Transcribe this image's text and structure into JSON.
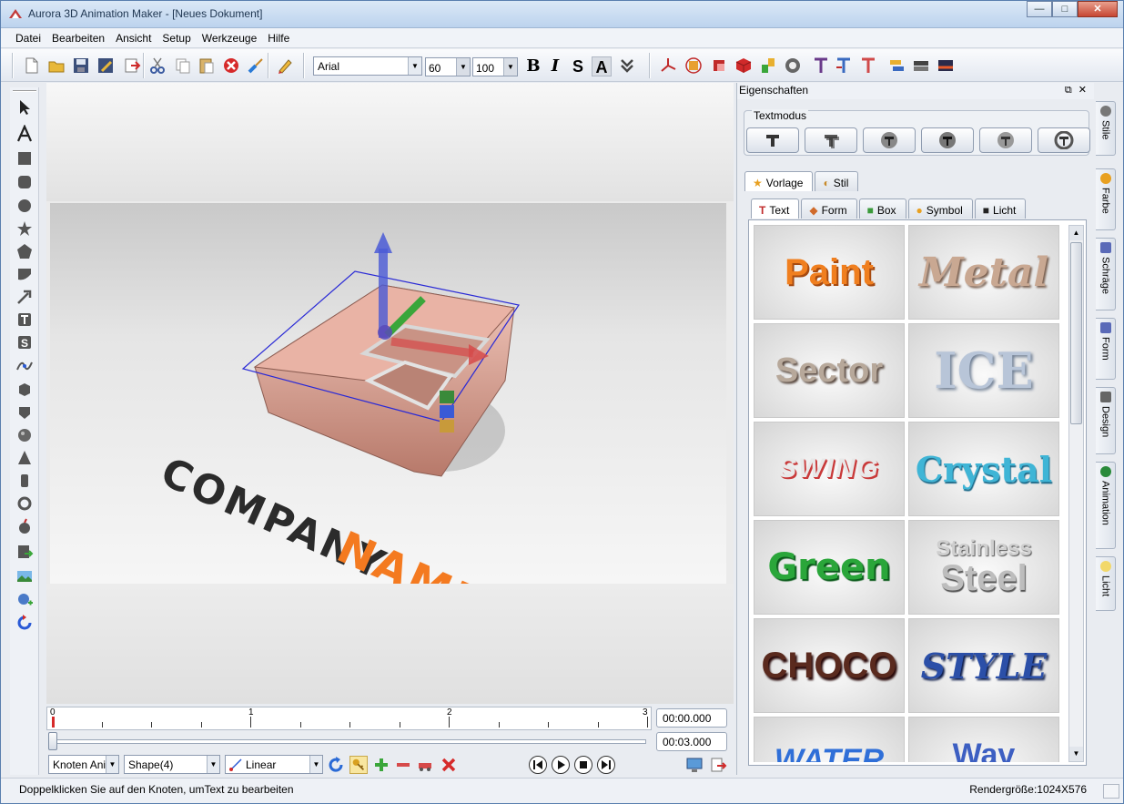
{
  "window": {
    "title": "Aurora 3D Animation Maker - [Neues Dokument]",
    "controls": {
      "minimize": "—",
      "maximize": "□",
      "close": "✕"
    }
  },
  "menu": [
    "Datei",
    "Bearbeiten",
    "Ansicht",
    "Setup",
    "Werkzeuge",
    "Hilfe"
  ],
  "toolbar": {
    "font": "Arial",
    "size": "60",
    "scale": "100",
    "bold": "B",
    "italic": "I",
    "shadow": "S",
    "outline": "A"
  },
  "canvas": {
    "text_line1": "COMPANY",
    "text_line2": "NAME",
    "colors": {
      "dark": "#2b2b2b",
      "accent": "#f47a20"
    }
  },
  "timeline": {
    "ticks": [
      "0",
      "1",
      "2",
      "3"
    ],
    "current_time": "00:00.000",
    "total_time": "00:03.000"
  },
  "bottom": {
    "anim_mode": "Knoten Ani",
    "shape": "Shape(4)",
    "interpolation": "Linear"
  },
  "status": {
    "message": "Doppelklicken Sie auf den Knoten, umText zu bearbeiten",
    "render_size": "Rendergröße:1024X576"
  },
  "properties": {
    "title": "Eigenschaften",
    "textmode_label": "Textmodus",
    "tabs_top": [
      "Vorlage",
      "Stil"
    ],
    "tabs_sub": [
      "Text",
      "Form",
      "Box",
      "Symbol",
      "Licht"
    ],
    "templates": [
      {
        "label": "Paint",
        "color": "#f07f1f"
      },
      {
        "label": "Metal",
        "color": "#c9a892"
      },
      {
        "label": "Sector",
        "color": "#b7a89a"
      },
      {
        "label": "ICE",
        "color": "#b8c5d8"
      },
      {
        "label": "SWING",
        "color": "#c93a3a"
      },
      {
        "label": "Crystal",
        "color": "#3fb5d6"
      },
      {
        "label": "Green",
        "color": "#2aa63a"
      },
      {
        "label": "Stainless",
        "color": "#a9a9a9"
      },
      {
        "label": "Steel",
        "color": "#8f8f8f"
      },
      {
        "label": "CHOCO",
        "color": "#5a2a1e"
      },
      {
        "label": "STYLE",
        "color": "#2b4fa8"
      },
      {
        "label": "WATER",
        "color": "#2f6fd8"
      },
      {
        "label": "Wav",
        "color": "#3d5fc2"
      }
    ],
    "side_tabs": [
      "Stile",
      "Farbe",
      "Schräge",
      "Form",
      "Design",
      "Animation",
      "Licht"
    ]
  }
}
